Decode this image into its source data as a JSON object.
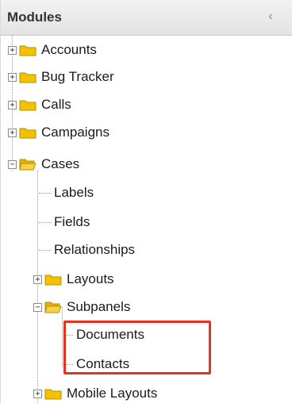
{
  "panel": {
    "title": "Modules",
    "collapse_icon": "chevron-left-icon"
  },
  "tree": {
    "accounts": "Accounts",
    "bug_tracker": "Bug Tracker",
    "calls": "Calls",
    "campaigns": "Campaigns",
    "cases": {
      "label": "Cases",
      "labels": "Labels",
      "fields": "Fields",
      "relationships": "Relationships",
      "layouts": "Layouts",
      "subpanels": {
        "label": "Subpanels",
        "documents": "Documents",
        "contacts": "Contacts"
      },
      "mobile_layouts": "Mobile Layouts"
    }
  },
  "colors": {
    "highlight": "#e53322",
    "folder": "#f2c200"
  }
}
